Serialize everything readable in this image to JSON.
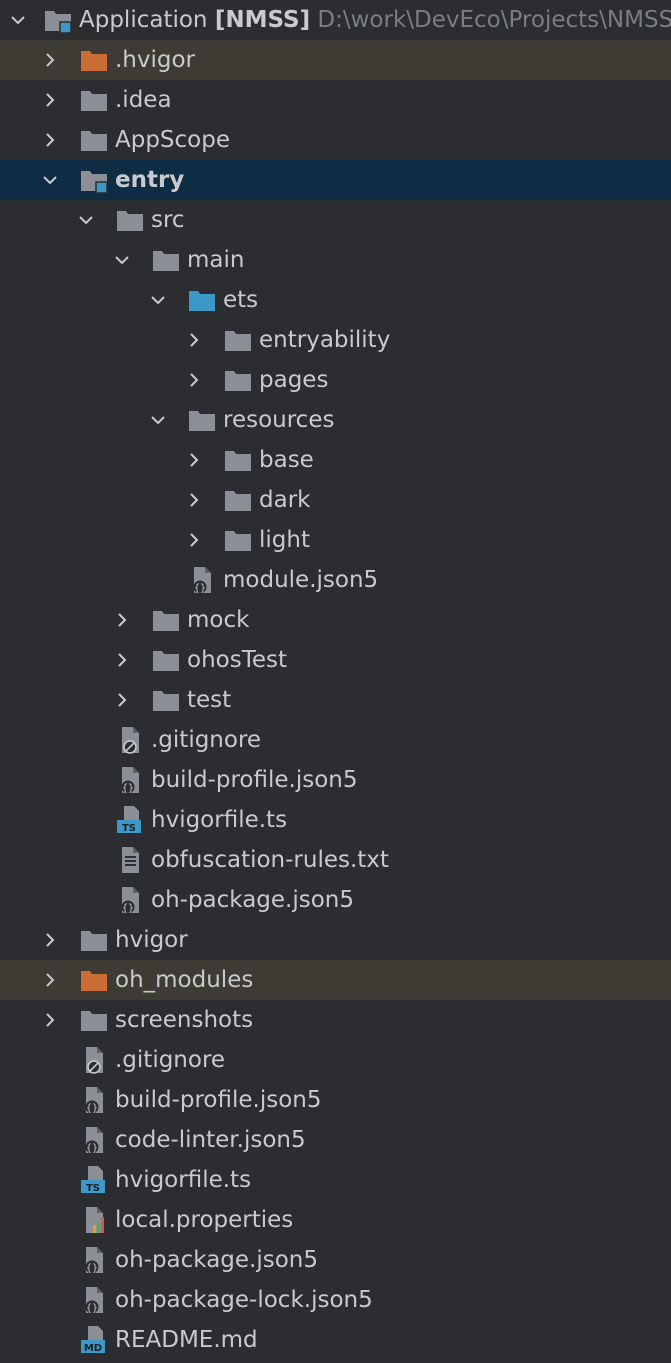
{
  "root": {
    "name": "Application",
    "module": "[NMSS]",
    "path": "D:\\work\\DevEco\\Projects\\NMSS"
  },
  "colors": {
    "folder": "#8c9096",
    "source_folder": "#3d97c9",
    "excluded_folder": "#cc6d37",
    "excluded_row": "#3e3b35",
    "selected_row": "#0e2c44",
    "background": "#2b2d30"
  },
  "rows": [
    {
      "label": ".hvigor",
      "icon": "folder-excluded-icon",
      "expander": "collapsed",
      "state": "excluded"
    },
    {
      "label": ".idea",
      "icon": "folder-icon",
      "expander": "collapsed"
    },
    {
      "label": "AppScope",
      "icon": "folder-icon",
      "expander": "collapsed"
    },
    {
      "label": "entry",
      "icon": "module-folder-icon",
      "expander": "expanded",
      "state": "selected"
    },
    {
      "label": "src",
      "icon": "folder-icon",
      "expander": "expanded"
    },
    {
      "label": "main",
      "icon": "folder-icon",
      "expander": "expanded"
    },
    {
      "label": "ets",
      "icon": "source-folder-icon",
      "expander": "expanded"
    },
    {
      "label": "entryability",
      "icon": "folder-icon",
      "expander": "collapsed"
    },
    {
      "label": "pages",
      "icon": "folder-icon",
      "expander": "collapsed"
    },
    {
      "label": "resources",
      "icon": "folder-icon",
      "expander": "expanded"
    },
    {
      "label": "base",
      "icon": "folder-icon",
      "expander": "collapsed"
    },
    {
      "label": "dark",
      "icon": "folder-icon",
      "expander": "collapsed"
    },
    {
      "label": "light",
      "icon": "folder-icon",
      "expander": "collapsed"
    },
    {
      "label": "module.json5",
      "icon": "json5-file-icon"
    },
    {
      "label": "mock",
      "icon": "folder-icon",
      "expander": "collapsed"
    },
    {
      "label": "ohosTest",
      "icon": "folder-icon",
      "expander": "collapsed"
    },
    {
      "label": "test",
      "icon": "folder-icon",
      "expander": "collapsed"
    },
    {
      "label": ".gitignore",
      "icon": "gitignore-file-icon"
    },
    {
      "label": "build-profile.json5",
      "icon": "json5-file-icon"
    },
    {
      "label": "hvigorfile.ts",
      "icon": "typescript-file-icon",
      "icon_text": "TS"
    },
    {
      "label": "obfuscation-rules.txt",
      "icon": "text-file-icon"
    },
    {
      "label": "oh-package.json5",
      "icon": "json5-file-icon"
    },
    {
      "label": "hvigor",
      "icon": "folder-icon",
      "expander": "collapsed"
    },
    {
      "label": "oh_modules",
      "icon": "folder-excluded-icon",
      "expander": "collapsed",
      "state": "excluded"
    },
    {
      "label": "screenshots",
      "icon": "folder-icon",
      "expander": "collapsed"
    },
    {
      "label": ".gitignore",
      "icon": "gitignore-file-icon"
    },
    {
      "label": "build-profile.json5",
      "icon": "json5-file-icon"
    },
    {
      "label": "code-linter.json5",
      "icon": "json5-file-icon"
    },
    {
      "label": "hvigorfile.ts",
      "icon": "typescript-file-icon",
      "icon_text": "TS"
    },
    {
      "label": "local.properties",
      "icon": "properties-file-icon"
    },
    {
      "label": "oh-package.json5",
      "icon": "json5-file-icon"
    },
    {
      "label": "oh-package-lock.json5",
      "icon": "json5-file-icon"
    },
    {
      "label": "README.md",
      "icon": "markdown-file-icon",
      "icon_text": "MD"
    }
  ]
}
